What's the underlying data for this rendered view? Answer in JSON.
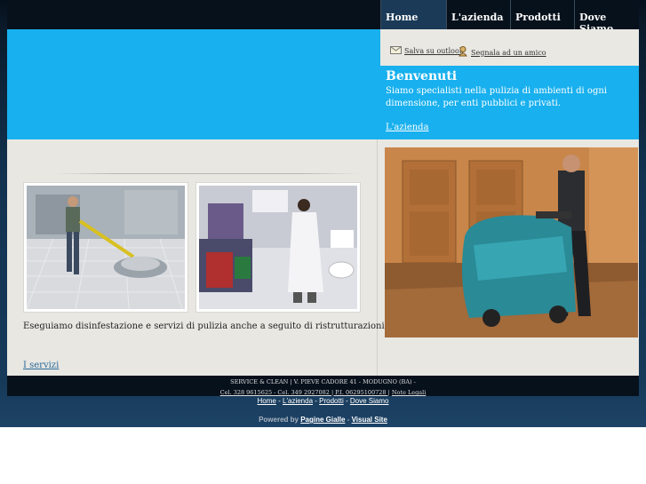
{
  "nav": {
    "items": [
      {
        "label": "Home"
      },
      {
        "label": "L'azienda"
      },
      {
        "label": "Prodotti"
      },
      {
        "label": "Dove Siamo"
      }
    ]
  },
  "utility": {
    "save_outlook": "Salva su outlook",
    "tell_friend": "Segnala ad un amico"
  },
  "welcome": {
    "title": "Benvenuti",
    "text": "Siamo specialisti nella pulizia di ambienti di ogni dimensione, per enti pubblici e privati.",
    "link": "L'azienda"
  },
  "main": {
    "description": "Eseguiamo disinfestazione e servizi di pulizia anche a seguito di ristrutturazioni.",
    "services_link": "I servizi"
  },
  "footer": {
    "address": "SERVICE & CLEAN | V. PIEVE CADORE 41 - MODUGNO (BA) -",
    "contacts": "Cel. 328 9615625 - Cel. 349 2927082 | P.I. 06295100728 |",
    "legal": "Note Legali",
    "nav": [
      "Home",
      "L'azienda",
      "Prodotti",
      "Dove Siamo"
    ],
    "separator": "-",
    "powered_by": "Powered by",
    "pagine_gialle": "Pagine Gialle",
    "visual_site": "Visual Site"
  },
  "colors": {
    "banner": "#18b0ee",
    "nav_bg": "#07111c",
    "nav_active": "#1b3a57",
    "content_bg": "#e8e7e2"
  }
}
